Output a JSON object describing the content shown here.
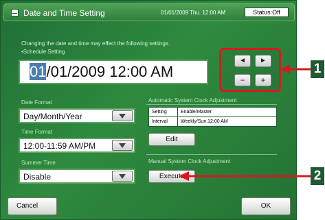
{
  "titlebar": {
    "title": "Date and Time Setting",
    "datetime": "01/01/2009 Thu. 12:00 AM",
    "status": "Status:Off"
  },
  "notice": {
    "line1": "Changing the date and time may effect the following settings.",
    "line2": "•Schedule Setting"
  },
  "datetime_display": {
    "highlighted": "01",
    "rest": "/01/2009 12:00 AM"
  },
  "arrows": {
    "left": "◄",
    "right": "►",
    "minus": "−",
    "plus": "+"
  },
  "date_format": {
    "label": "Date Format",
    "value": "Day/Month/Year"
  },
  "time_format": {
    "label": "Time Format",
    "value": "12:00-11:59 AM/PM"
  },
  "summer_time": {
    "label": "Summer Time",
    "value": "Disable"
  },
  "auto_clock": {
    "heading": "Automatic System Clock Adjustment",
    "rows": [
      {
        "key": "Setting",
        "value": "Enable/Master"
      },
      {
        "key": "Interval",
        "value": "Weekly/Sun.12:00 AM"
      }
    ],
    "edit_label": "Edit"
  },
  "manual_clock": {
    "heading": "Manual System Clock Adjustment",
    "execute_label": "Execute"
  },
  "footer": {
    "cancel_label": "Cancel",
    "ok_label": "OK"
  },
  "callouts": {
    "one": "1",
    "two": "2"
  },
  "colors": {
    "accent_red": "#d71920",
    "panel_green": "#2f8a3e",
    "callout_bg": "#1f5a33"
  }
}
